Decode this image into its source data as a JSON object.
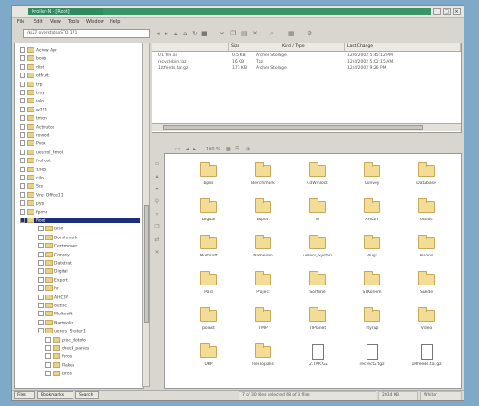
{
  "window": {
    "title": "Kroller-N - [Root]",
    "min": "_",
    "max": "□",
    "close": "×"
  },
  "menu": [
    "File",
    "Edit",
    "View",
    "Tools",
    "Window",
    "Help"
  ],
  "location": "/ki27 oyerstotsoSTO 171",
  "toolbar_icons": [
    "back-icon",
    "forward-icon",
    "up-icon",
    "home-icon",
    "refresh-icon",
    "stop-icon",
    "cut-icon",
    "copy-icon",
    "paste-icon",
    "delete-icon",
    "find-icon"
  ],
  "tree": [
    {
      "label": "Acrow Apr",
      "sel": false
    },
    {
      "label": "boob",
      "sel": false
    },
    {
      "label": "dist",
      "sel": false
    },
    {
      "label": "otfruit",
      "sel": false
    },
    {
      "label": "trp",
      "sel": false
    },
    {
      "label": "troy",
      "sel": false
    },
    {
      "label": "ialo",
      "sel": false
    },
    {
      "label": "w711",
      "sel": false
    },
    {
      "label": "tmon",
      "sel": false
    },
    {
      "label": "Actirutos",
      "sel": false
    },
    {
      "label": "rovrod",
      "sel": false
    },
    {
      "label": "Pvox",
      "sel": false
    },
    {
      "label": "uestrol_hmol",
      "sel": false
    },
    {
      "label": "frohost",
      "sel": false
    },
    {
      "label": "1985",
      "sel": false
    },
    {
      "label": "cilo",
      "sel": false
    },
    {
      "label": "Srs",
      "sel": false
    },
    {
      "label": "Vret Office11",
      "sel": false
    },
    {
      "label": "pyp",
      "sel": false
    },
    {
      "label": "fprmr",
      "sel": false
    },
    {
      "label": "Root",
      "sel": true
    },
    {
      "label": "Bisx",
      "sel": false
    },
    {
      "label": "Bonchmark",
      "sel": false
    },
    {
      "label": "Certimover",
      "sel": false
    },
    {
      "label": "Convey",
      "sel": false
    },
    {
      "label": "Datetrat",
      "sel": false
    },
    {
      "label": "Digital",
      "sel": false
    },
    {
      "label": "Export",
      "sel": false
    },
    {
      "label": "hr",
      "sel": false
    },
    {
      "label": "AHCBY",
      "sel": false
    },
    {
      "label": "outloc",
      "sel": false
    },
    {
      "label": "Multisoft",
      "sel": false
    },
    {
      "label": "Nameolin",
      "sel": false
    },
    {
      "label": "uerers_Systeri1",
      "sel": false
    },
    {
      "label": "proc_dototo",
      "sel": false
    },
    {
      "label": "check_parses",
      "sel": false
    },
    {
      "label": "foros",
      "sel": false
    },
    {
      "label": "Plakes",
      "sel": false
    },
    {
      "label": "Eiros",
      "sel": false
    }
  ],
  "details": {
    "columns": [
      "",
      "Size",
      "Kind / Type",
      "Last Change"
    ],
    "rows": [
      {
        "name": "0.1 file.ai",
        "size": "0.5 KB",
        "type": "Archer Storage",
        "date": "12/6/2002 5:45:12 PM"
      },
      {
        "name": "recyclebin.tgz",
        "size": "16 KB",
        "type": "Tgz",
        "date": "12/4/2002 5:02:15 AM"
      },
      {
        "name": "1stfeeds.tar.gz",
        "size": "173 KB",
        "type": "Archer Storage",
        "date": "12/4/2002 9:26 PM"
      }
    ]
  },
  "icon_bar": [
    "view-icon",
    "back-icon",
    "forward-icon",
    "percent-icon",
    "grid-icon",
    "list-icon",
    "zoom-icon"
  ],
  "icon_bar_label": "100 %",
  "side_buttons": [
    "dir-icon",
    "up-icon",
    "down-icon",
    "link-icon",
    "filter-icon",
    "copy-icon",
    "move-icon",
    "delete-icon"
  ],
  "items": [
    {
      "label": "bpbs",
      "type": "folder"
    },
    {
      "label": "Benchmark",
      "type": "folder"
    },
    {
      "label": "CdWinlock",
      "type": "folder"
    },
    {
      "label": "Convey",
      "type": "folder"
    },
    {
      "label": "Database",
      "type": "folder"
    },
    {
      "label": "Digital",
      "type": "folder"
    },
    {
      "label": "Export",
      "type": "folder"
    },
    {
      "label": "hr",
      "type": "folder"
    },
    {
      "label": "AHCBY",
      "type": "folder"
    },
    {
      "label": "outloc",
      "type": "folder"
    },
    {
      "label": "Multisoft",
      "type": "folder"
    },
    {
      "label": "Nameolin",
      "type": "folder"
    },
    {
      "label": "uerers_Systeri",
      "type": "folder"
    },
    {
      "label": "Plugs",
      "type": "folder"
    },
    {
      "label": "Pinons",
      "type": "folder"
    },
    {
      "label": "Paid",
      "type": "folder"
    },
    {
      "label": "Project",
      "type": "folder"
    },
    {
      "label": "Sortline",
      "type": "folder"
    },
    {
      "label": "STKonom",
      "type": "folder"
    },
    {
      "label": "Suede",
      "type": "folder"
    },
    {
      "label": "poinst",
      "type": "folder"
    },
    {
      "label": "TMP",
      "type": "folder"
    },
    {
      "label": "TIPlanet",
      "type": "folder"
    },
    {
      "label": "Ttyrup",
      "type": "folder"
    },
    {
      "label": "Video",
      "type": "folder"
    },
    {
      "label": "UKP",
      "type": "folder"
    },
    {
      "label": "RecTopans",
      "type": "folder"
    },
    {
      "label": "T2.TAR.GZ",
      "type": "file"
    },
    {
      "label": "recrect2.tgz",
      "type": "file"
    },
    {
      "label": "1Mfeeds.tar.gz",
      "type": "file"
    }
  ],
  "status": {
    "tabs": [
      "Files",
      "Bookmarks",
      "Search"
    ],
    "info": "7 of 30 files selected 68 of 3 files",
    "size": "2034 KB",
    "user": "Whiter"
  },
  "colors": {
    "accent": "#2f8a5e",
    "selection": "#1c2f7a",
    "folder": "#f2dc96",
    "desktop": "#7fa9c9"
  }
}
